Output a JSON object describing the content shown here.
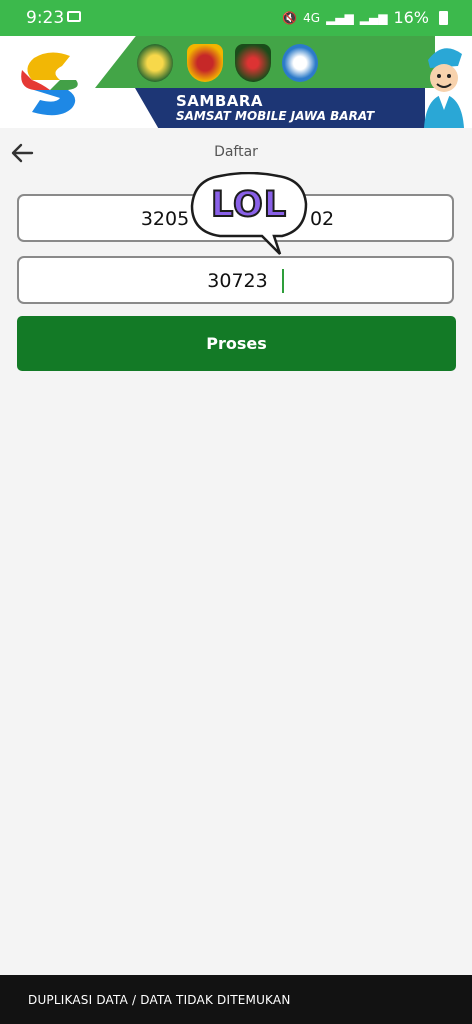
{
  "status_bar": {
    "time": "9:23",
    "network": "4G",
    "battery": "16%"
  },
  "banner": {
    "brand_title": "SAMBARA",
    "brand_subtitle": "SAMSAT MOBILE JAWA BARAT",
    "colors": {
      "green": "#43a547",
      "navy": "#1d3675"
    }
  },
  "screen": {
    "title": "Daftar",
    "back_icon": "arrow-left-icon"
  },
  "form": {
    "field1_value": "3205                    02",
    "field2_value": "30723",
    "submit_label": "Proses"
  },
  "sticker": {
    "text": "LOL",
    "color": "#8a61e8"
  },
  "snackbar": {
    "message": "DUPLIKASI DATA / DATA TIDAK DITEMUKAN"
  },
  "accent": "#137a26"
}
